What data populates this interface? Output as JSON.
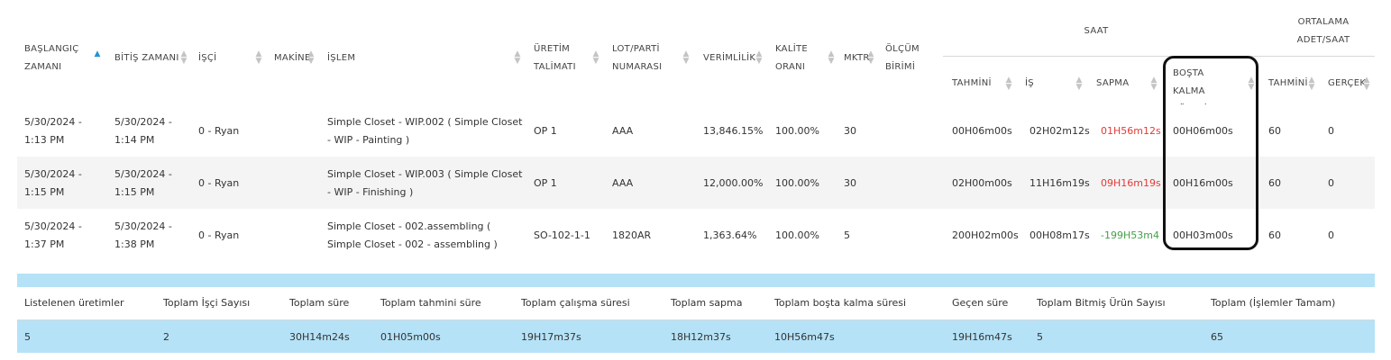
{
  "headers": {
    "start_time": "BAŞLANGIÇ ZAMANI",
    "end_time": "BİTİŞ ZAMANI",
    "worker": "İŞÇİ",
    "machine": "MAKİNE",
    "operation": "İŞLEM",
    "production_order": "ÜRETİM TALİMATI",
    "lot": "LOT/PARTİ NUMARASI",
    "efficiency": "VERİMLİLİK",
    "quality": "KALİTE ORANI",
    "qty": "MKTR",
    "unit": "ÖLÇÜM BİRİMİ",
    "hour_group": "SAAT",
    "avg_group": "ORTALAMA ADET/SAAT",
    "estimated": "TAHMİNİ",
    "work": "İŞ",
    "deviation": "SAPMA",
    "idle": "BOŞTA KALMA SÜRESİ",
    "avg_estimated": "TAHMİNİ",
    "avg_actual": "GERÇEK"
  },
  "rows": [
    {
      "start": "5/30/2024 - 1:13 PM",
      "end": "5/30/2024 - 1:14 PM",
      "worker": "0 - Ryan",
      "machine": "",
      "operation": "Simple Closet - WIP.002 ( Simple Closet - WIP - Painting )",
      "order": "OP 1",
      "lot": "AAA",
      "efficiency": "13,846.15%",
      "quality": "100.00%",
      "qty": "30",
      "unit": "",
      "estimated": "00H06m00s",
      "work": "02H02m12s",
      "deviation": "01H56m12s",
      "idle": "00H06m00s",
      "avg_est": "60",
      "avg_act": "0"
    },
    {
      "start": "5/30/2024 - 1:15 PM",
      "end": "5/30/2024 - 1:15 PM",
      "worker": "0 - Ryan",
      "machine": "",
      "operation": "Simple Closet - WIP.003 ( Simple Closet - WIP - Finishing )",
      "order": "OP 1",
      "lot": "AAA",
      "efficiency": "12,000.00%",
      "quality": "100.00%",
      "qty": "30",
      "unit": "",
      "estimated": "02H00m00s",
      "work": "11H16m19s",
      "deviation": "09H16m19s",
      "idle": "00H16m00s",
      "avg_est": "60",
      "avg_act": "0"
    },
    {
      "start": "5/30/2024 - 1:37 PM",
      "end": "5/30/2024 - 1:38 PM",
      "worker": "0 - Ryan",
      "machine": "",
      "operation": "Simple Closet - 002.assembling ( Simple Closet - 002 - assembling )",
      "order": "SO-102-1-1",
      "lot": "1820AR",
      "efficiency": "1,363.64%",
      "quality": "100.00%",
      "qty": "5",
      "unit": "",
      "estimated": "200H02m00s",
      "work": "00H08m17s",
      "deviation": "-199H53m43s",
      "idle": "00H03m00s",
      "avg_est": "60",
      "avg_act": "0"
    }
  ],
  "summary": {
    "labels": {
      "listed": "Listelenen üretimler",
      "workers": "Toplam İşçi Sayısı",
      "total_time": "Toplam süre",
      "total_estimated": "Toplam tahmini süre",
      "total_work": "Toplam çalışma süresi",
      "total_deviation": "Toplam sapma",
      "total_idle": "Toplam boşta kalma süresi",
      "elapsed": "Geçen süre",
      "finished": "Toplam Bitmiş Ürün Sayısı",
      "total_ops": "Toplam (İşlemler Tamam)"
    },
    "values": {
      "listed": "5",
      "workers": "2",
      "total_time": "30H14m24s",
      "total_estimated": "01H05m00s",
      "total_work": "19H17m37s",
      "total_deviation": "18H12m37s",
      "total_idle": "10H56m47s",
      "elapsed": "19H16m47s",
      "finished": "5",
      "total_ops": "65"
    }
  },
  "colors": {
    "sort_active": "#1f95d3",
    "deviation_positive": "#e53935",
    "deviation_negative": "#43a047",
    "summary_band": "#b5e2f7",
    "stripe": "#f4f4f4"
  }
}
